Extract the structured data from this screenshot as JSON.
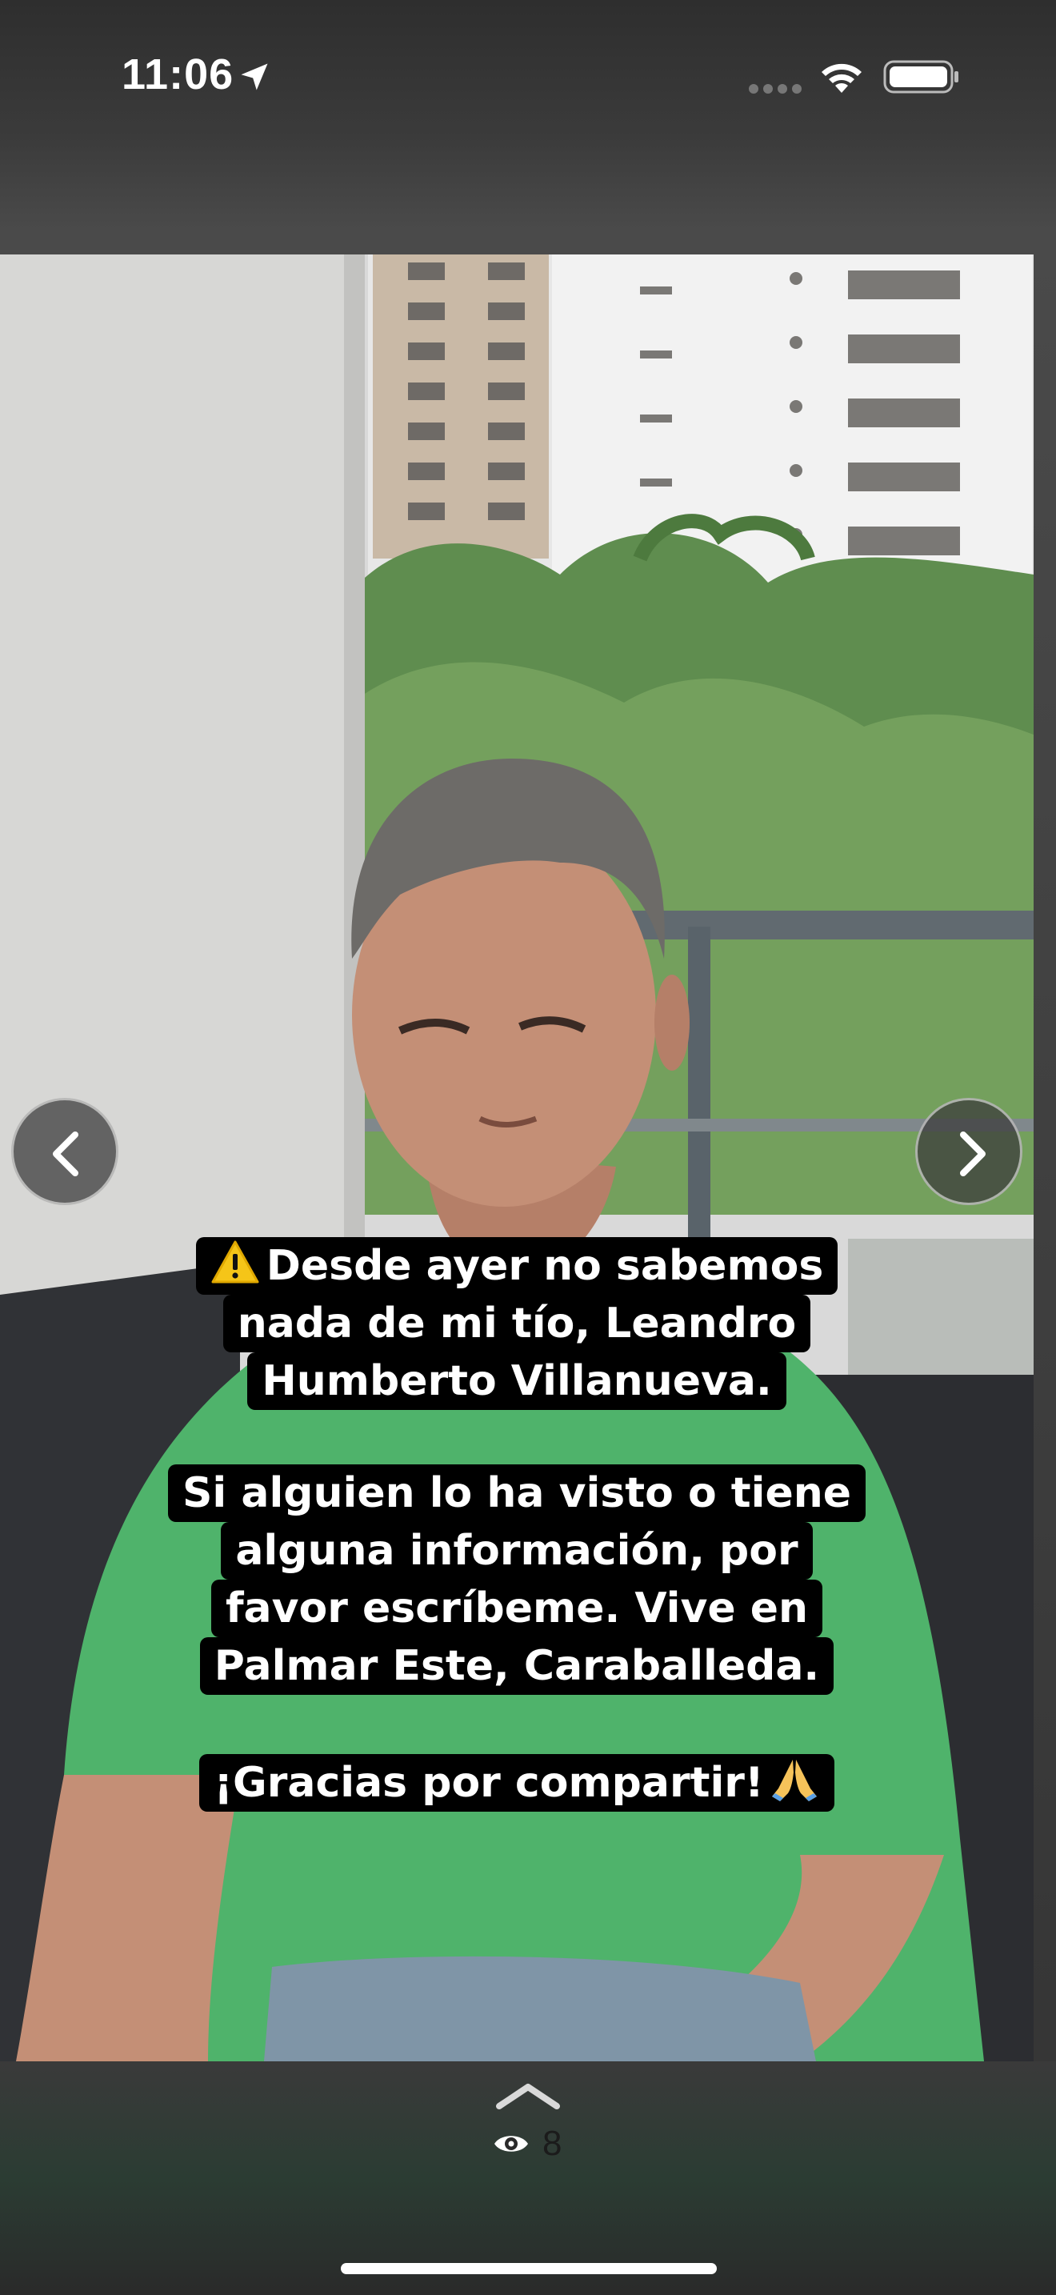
{
  "status_bar": {
    "time": "11:06",
    "icons": [
      "location-arrow-icon",
      "cellular-signal-icon",
      "wifi-icon",
      "battery-icon"
    ]
  },
  "story": {
    "caption_1": {
      "icon": "warning-icon",
      "lines": [
        "Desde ayer no sabemos",
        "nada de mi tío, Leandro",
        "Humberto Villanueva."
      ]
    },
    "caption_2": {
      "lines": [
        "Si alguien lo ha visto o tiene",
        "alguna información, por",
        "favor escríbeme. Vive en",
        "Palmar Este, Caraballeda."
      ]
    },
    "caption_3": {
      "line": "¡Gracias por compartir!",
      "icon": "praying-hands-icon"
    },
    "nav": {
      "prev_icon": "chevron-left-icon",
      "next_icon": "chevron-right-icon"
    }
  },
  "footer": {
    "swipe_icon": "chevron-up-icon",
    "views_icon": "eye-icon",
    "view_count": "8"
  },
  "colors": {
    "caption_bg": "#000000",
    "caption_text": "#ffffff",
    "shirt_green": "#4fb36b"
  }
}
